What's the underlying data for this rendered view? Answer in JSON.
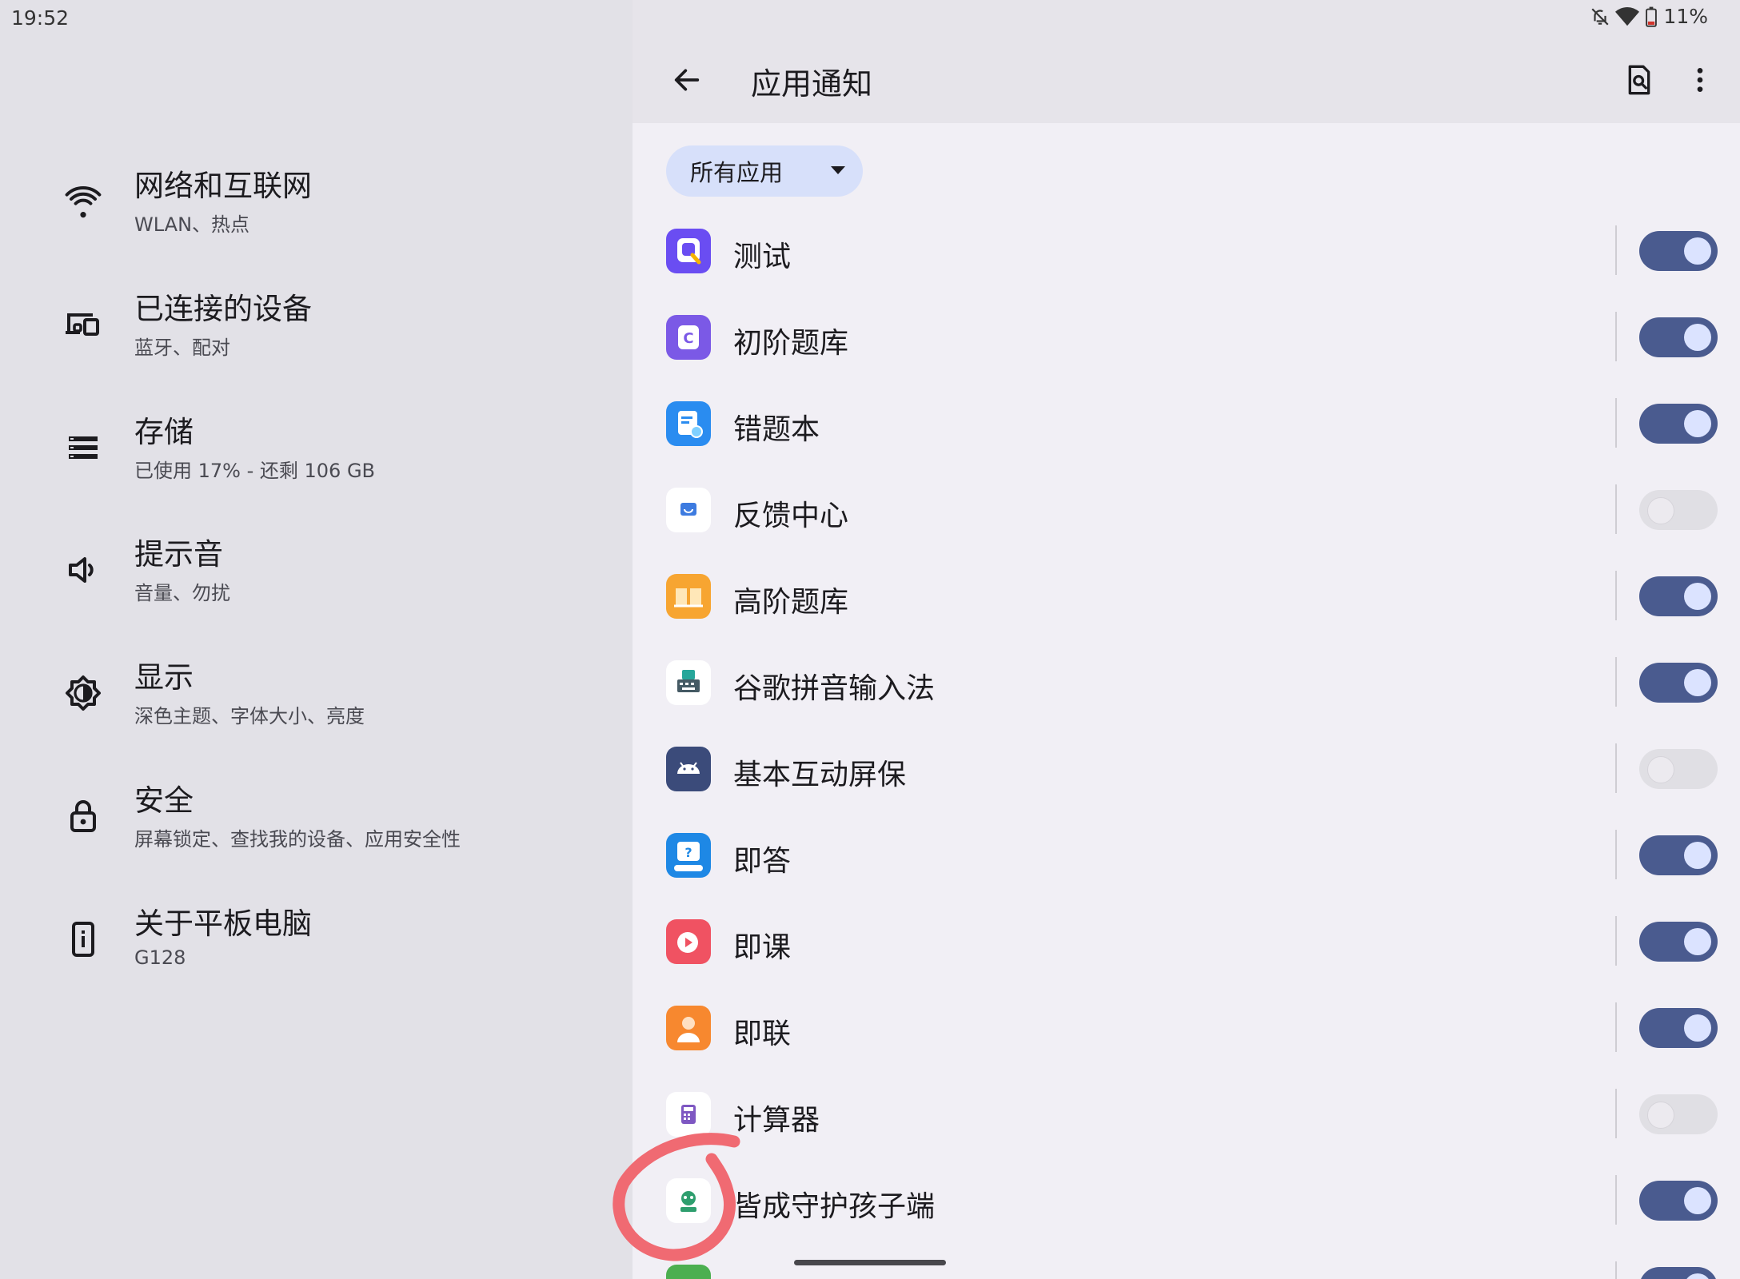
{
  "status": {
    "time": "19:52",
    "battery": "11%"
  },
  "nav": {
    "items": [
      {
        "title": "网络和互联网",
        "subtitle": "WLAN、热点",
        "icon": "wifi-icon"
      },
      {
        "title": "已连接的设备",
        "subtitle": "蓝牙、配对",
        "icon": "devices-icon"
      },
      {
        "title": "存储",
        "subtitle": "已使用 17% - 还剩 106 GB",
        "icon": "storage-icon"
      },
      {
        "title": "提示音",
        "subtitle": "音量、勿扰",
        "icon": "volume-icon"
      },
      {
        "title": "显示",
        "subtitle": "深色主题、字体大小、亮度",
        "icon": "brightness-icon"
      },
      {
        "title": "安全",
        "subtitle": "屏幕锁定、查找我的设备、应用安全性",
        "icon": "lock-icon"
      },
      {
        "title": "关于平板电脑",
        "subtitle": "G128",
        "icon": "tablet-info-icon"
      }
    ]
  },
  "header": {
    "title": "应用通知"
  },
  "filter": {
    "label": "所有应用"
  },
  "apps": [
    {
      "name": "测试",
      "enabled": true
    },
    {
      "name": "初阶题库",
      "enabled": true
    },
    {
      "name": "错题本",
      "enabled": true
    },
    {
      "name": "反馈中心",
      "enabled": false
    },
    {
      "name": "高阶题库",
      "enabled": true
    },
    {
      "name": "谷歌拼音输入法",
      "enabled": true
    },
    {
      "name": "基本互动屏保",
      "enabled": false
    },
    {
      "name": "即答",
      "enabled": true
    },
    {
      "name": "即课",
      "enabled": true
    },
    {
      "name": "即联",
      "enabled": true
    },
    {
      "name": "计算器",
      "enabled": false
    },
    {
      "name": "皆成守护孩子端",
      "enabled": true
    }
  ],
  "colors": {
    "toggle_on": "#4a5b8f",
    "toggle_off": "#e0dfe4",
    "filter_chip": "#d7e0fa",
    "annotation": "#f06a72"
  }
}
